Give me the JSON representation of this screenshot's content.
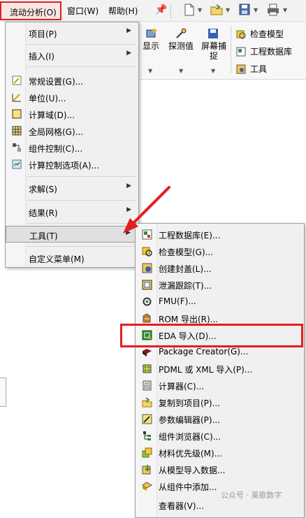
{
  "menubar": {
    "items": [
      "流动分析(O)",
      "窗口(W)",
      "帮助(H)"
    ]
  },
  "ribbon": {
    "buttons": [
      "显示",
      "探测值",
      "屏幕捕捉"
    ],
    "right_items": [
      "检查模型",
      "工程数据库",
      "工具"
    ]
  },
  "menu1": {
    "items": [
      {
        "label": "项目(P)",
        "submenu": true
      },
      {
        "label": "插入(I)",
        "submenu": true
      },
      {
        "label": "常规设置(G)...",
        "icon": "settings-icon"
      },
      {
        "label": "单位(U)...",
        "icon": "units-icon"
      },
      {
        "label": "计算域(D)...",
        "icon": "domain-icon"
      },
      {
        "label": "全局网格(G)...",
        "icon": "mesh-icon"
      },
      {
        "label": "组件控制(C)...",
        "icon": "component-icon"
      },
      {
        "label": "计算控制选项(A)...",
        "icon": "calc-control-icon"
      },
      {
        "label": "求解(S)",
        "submenu": true
      },
      {
        "label": "结果(R)",
        "submenu": true
      },
      {
        "label": "工具(T)",
        "submenu": true,
        "highlighted": true
      },
      {
        "label": "自定义菜单(M)"
      }
    ]
  },
  "menu2": {
    "items": [
      {
        "label": "工程数据库(E)...",
        "icon": "database-icon"
      },
      {
        "label": "检查模型(G)...",
        "icon": "check-model-icon"
      },
      {
        "label": "创建封盖(L)...",
        "icon": "lid-icon"
      },
      {
        "label": "泄漏跟踪(T)...",
        "icon": "leak-icon"
      },
      {
        "label": "FMU(F)...",
        "icon": "fmu-icon"
      },
      {
        "label": "ROM 导出(R)...",
        "icon": "rom-icon"
      },
      {
        "label": "EDA 导入(D)...",
        "icon": "eda-icon",
        "boxed": true
      },
      {
        "label": "Package Creator(G)...",
        "icon": "package-icon"
      },
      {
        "label": "PDML 或 XML 导入(P)...",
        "icon": "pdml-icon"
      },
      {
        "label": "计算器(C)...",
        "icon": "calculator-icon"
      },
      {
        "label": "复制到项目(P)...",
        "icon": "copy-icon"
      },
      {
        "label": "参数编辑器(P)...",
        "icon": "param-icon"
      },
      {
        "label": "组件浏览器(C)...",
        "icon": "browser-icon"
      },
      {
        "label": "材料优先级(M)...",
        "icon": "material-icon"
      },
      {
        "label": "从模型导入数据...",
        "icon": "import-icon"
      },
      {
        "label": "从组件中添加...",
        "icon": "add-icon"
      },
      {
        "label": "查看器(V)...",
        "icon": "viewer-icon"
      }
    ]
  },
  "watermark": "公众号 · 莱歌数字",
  "colors": {
    "highlight_red": "#e31e1e",
    "arrow_red": "#e31e1e"
  }
}
